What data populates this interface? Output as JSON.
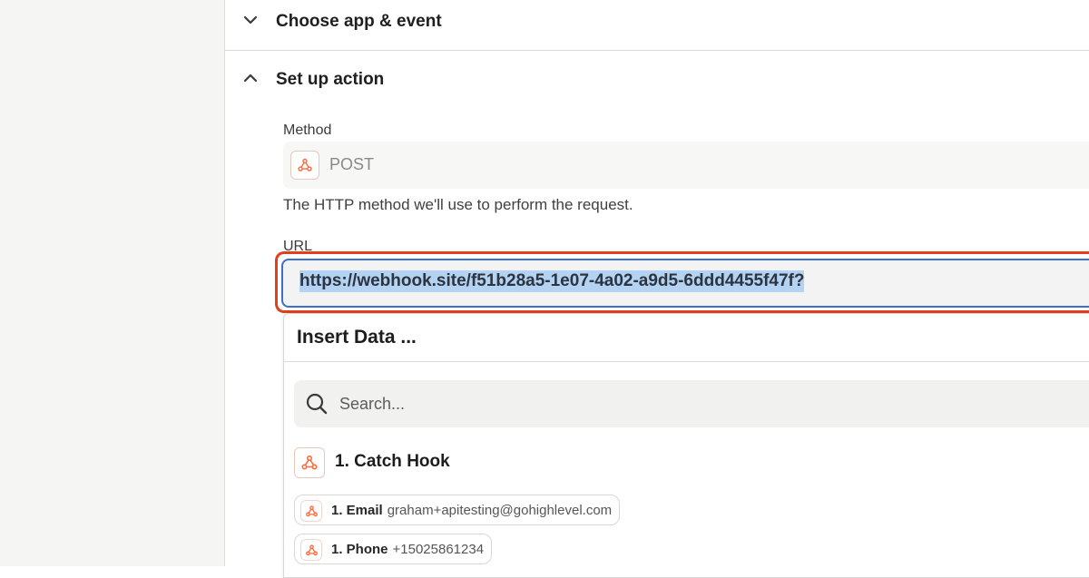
{
  "sections": {
    "choose_app": {
      "title": "Choose app & event",
      "expanded": false
    },
    "setup_action": {
      "title": "Set up action",
      "expanded": true
    }
  },
  "method": {
    "label": "Method",
    "value": "POST",
    "help": "The HTTP method we'll use to perform the request."
  },
  "url": {
    "label": "URL",
    "value": "https://webhook.site/f51b28a5-1e07-4a02-a9d5-6ddd4455f47f?"
  },
  "insert_data": {
    "title": "Insert Data ...",
    "search_placeholder": "Search...",
    "step": {
      "title": "1. Catch Hook",
      "icon": "webhooks-icon"
    },
    "fields": [
      {
        "key": "1. Email",
        "value": "graham+apitesting@gohighlevel.com"
      },
      {
        "key": "1. Phone",
        "value": "+15025861234"
      }
    ]
  },
  "colors": {
    "brand_orange": "#ff4f00",
    "highlight_border": "#e0401c",
    "focus_border": "#3d70c8",
    "selection": "#b4d2f2"
  }
}
